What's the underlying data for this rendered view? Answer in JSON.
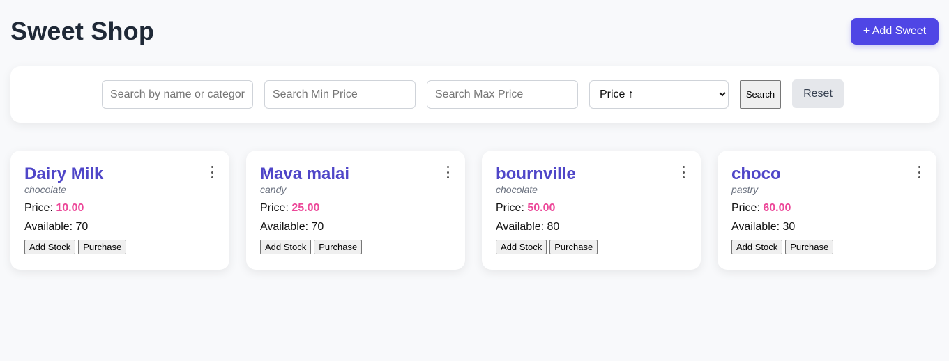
{
  "header": {
    "title": "Sweet Shop",
    "add_button_label": "+ Add Sweet"
  },
  "filters": {
    "search_placeholder": "Search by name or category",
    "min_price_placeholder": "Search Min Price",
    "max_price_placeholder": "Search Max Price",
    "sort_selected": "Price ↑",
    "search_label": "Search",
    "reset_label": "Reset"
  },
  "card_labels": {
    "price_prefix": "Price: ",
    "available_prefix": "Available: ",
    "add_stock_label": "Add Stock",
    "purchase_label": "Purchase"
  },
  "sweets": [
    {
      "name": "Dairy Milk",
      "category": "chocolate",
      "price": "10.00",
      "available": "70"
    },
    {
      "name": "Mava malai",
      "category": "candy",
      "price": "25.00",
      "available": "70"
    },
    {
      "name": "bournville",
      "category": "chocolate",
      "price": "50.00",
      "available": "80"
    },
    {
      "name": "choco",
      "category": "pastry",
      "price": "60.00",
      "available": "30"
    }
  ],
  "colors": {
    "accent": "#4f46e5",
    "name": "#4f46c8",
    "price": "#ec4899"
  },
  "icons": {
    "card_menu": "more-vertical-icon"
  }
}
